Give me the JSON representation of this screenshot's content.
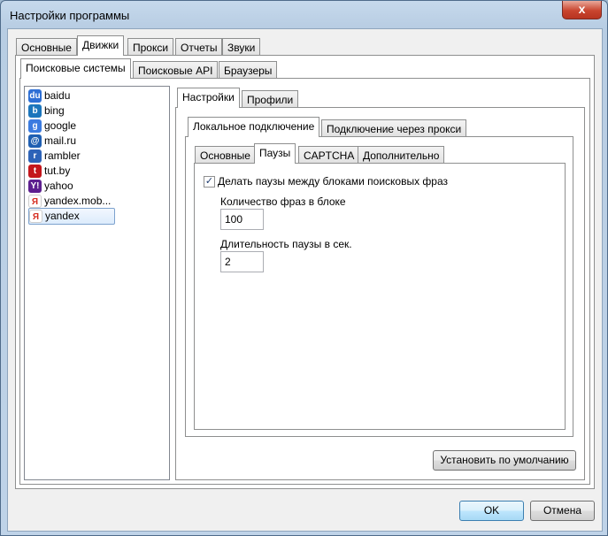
{
  "window": {
    "title": "Настройки программы",
    "close_glyph": "x"
  },
  "main_tabs": [
    "Основные",
    "Движки",
    "Прокси",
    "Отчеты",
    "Звуки"
  ],
  "sub_tabs": [
    "Поисковые системы",
    "Поисковые API",
    "Браузеры"
  ],
  "engines": [
    {
      "label": "baidu",
      "icon": "baidu-icon",
      "glyph": "du",
      "color": "#2d6fd5"
    },
    {
      "label": "bing",
      "icon": "bing-icon",
      "glyph": "b",
      "color": "#1b75bc"
    },
    {
      "label": "google",
      "icon": "google-icon",
      "glyph": "g",
      "color": "#3b7be0"
    },
    {
      "label": "mail.ru",
      "icon": "mailru-icon",
      "glyph": "@",
      "color": "#1f5fb2"
    },
    {
      "label": "rambler",
      "icon": "rambler-icon",
      "glyph": "r",
      "color": "#2d63b8"
    },
    {
      "label": "tut.by",
      "icon": "tutby-icon",
      "glyph": "t",
      "color": "#c4161c"
    },
    {
      "label": "yahoo",
      "icon": "yahoo-icon",
      "glyph": "Y!",
      "color": "#5d1f8f"
    },
    {
      "label": "yandex.mob...",
      "icon": "yandex-mobile-icon",
      "glyph": "Я",
      "color": "#d52b1e"
    },
    {
      "label": "yandex",
      "icon": "yandex-icon",
      "glyph": "Я",
      "color": "#d52b1e"
    }
  ],
  "settings_tabs": [
    "Настройки",
    "Профили"
  ],
  "connection_tabs": [
    "Локальное подключение",
    "Подключение через прокси"
  ],
  "detail_tabs": [
    "Основные",
    "Паузы",
    "CAPTCHA",
    "Дополнительно"
  ],
  "pauses": {
    "enable_label": "Делать паузы между блоками поисковых фраз",
    "enable_checked": "✓",
    "phrases_label": "Количество фраз в блоке",
    "phrases_value": "100",
    "duration_label": "Длительность паузы в сек.",
    "duration_value": "2"
  },
  "buttons": {
    "defaults": "Установить по умолчанию",
    "ok": "OK",
    "cancel": "Отмена"
  }
}
